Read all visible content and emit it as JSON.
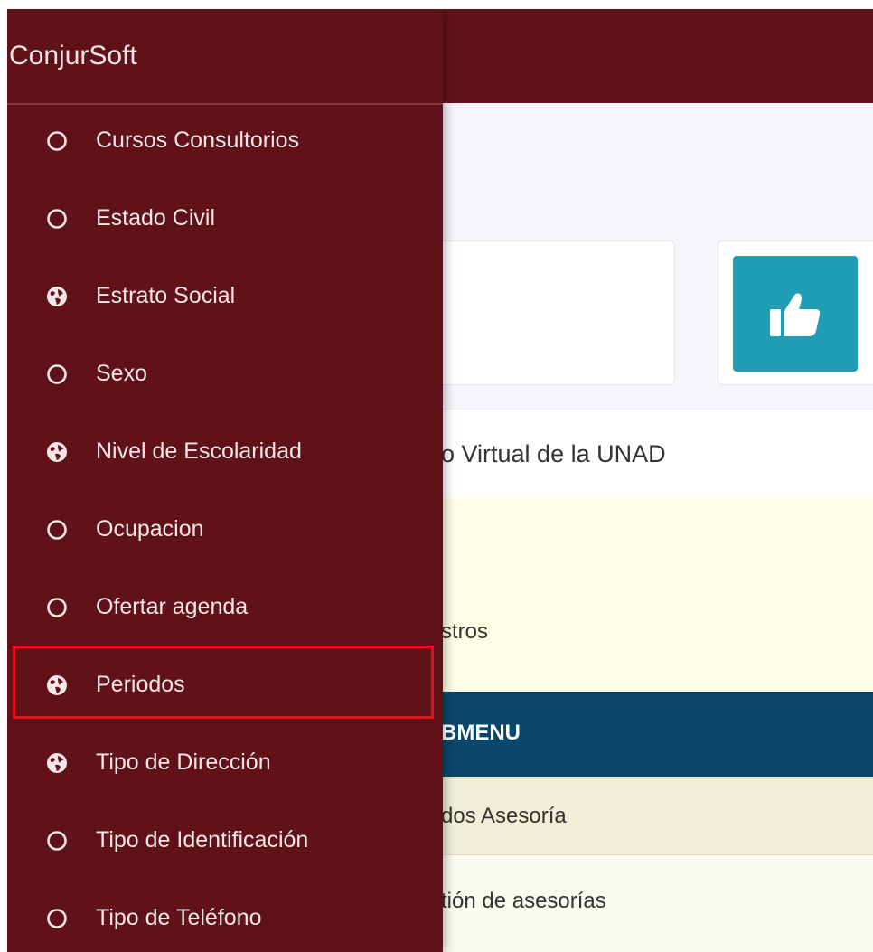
{
  "brand": "ConjurSoft",
  "sidebar": {
    "items": [
      {
        "label": "Cursos Consultorios",
        "icon": "circle-outline-icon"
      },
      {
        "label": "Estado Civil",
        "icon": "circle-outline-icon"
      },
      {
        "label": "Estrato Social",
        "icon": "globe-icon"
      },
      {
        "label": "Sexo",
        "icon": "circle-outline-icon"
      },
      {
        "label": "Nivel de Escolaridad",
        "icon": "globe-icon"
      },
      {
        "label": "Ocupacion",
        "icon": "circle-outline-icon"
      },
      {
        "label": "Ofertar agenda",
        "icon": "circle-outline-icon"
      },
      {
        "label": "Periodos",
        "icon": "globe-icon",
        "highlighted": true
      },
      {
        "label": "Tipo de Dirección",
        "icon": "globe-icon"
      },
      {
        "label": "Tipo de Identificación",
        "icon": "circle-outline-icon"
      },
      {
        "label": "Tipo de Teléfono",
        "icon": "circle-outline-icon"
      }
    ]
  },
  "main": {
    "info_box_icon": "thumbs-up-icon",
    "panel_title": "o Virtual de la UNAD",
    "alert_text": "stros",
    "submenu_header": "BMENU",
    "rows": [
      "dos Asesoría",
      "tión de asesorías"
    ]
  },
  "colors": {
    "sidebar_bg": "#611219",
    "highlight_border": "#e0141c",
    "submenu_bg": "#0a4669",
    "info_icon_bg": "#1f9db4"
  }
}
